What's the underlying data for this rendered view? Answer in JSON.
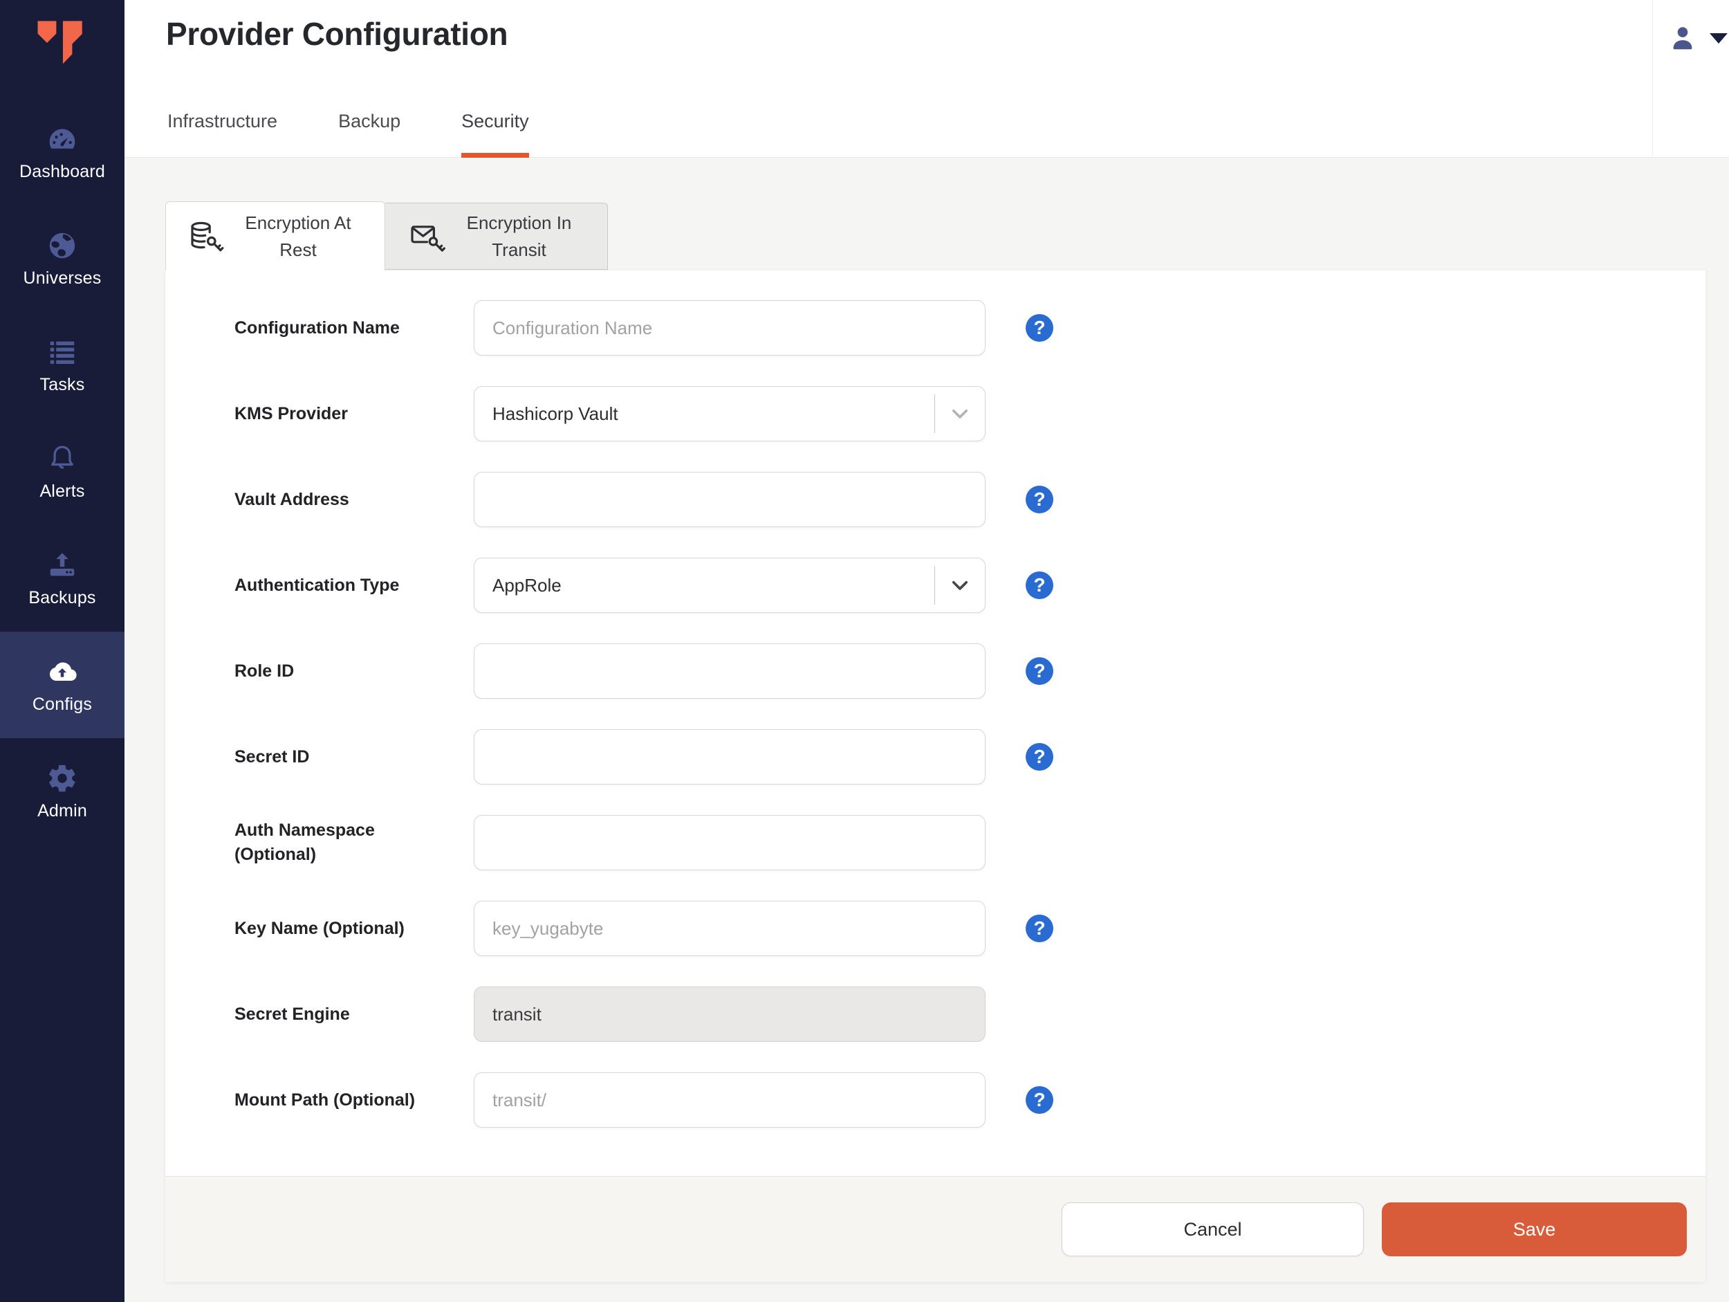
{
  "sidebar": {
    "items": [
      {
        "label": "Dashboard",
        "icon": "gauge-icon",
        "active": false
      },
      {
        "label": "Universes",
        "icon": "globe-icon",
        "active": false
      },
      {
        "label": "Tasks",
        "icon": "task-list-icon",
        "active": false
      },
      {
        "label": "Alerts",
        "icon": "bell-icon",
        "active": false
      },
      {
        "label": "Backups",
        "icon": "backup-upload-icon",
        "active": false
      },
      {
        "label": "Configs",
        "icon": "cloud-upload-icon",
        "active": true
      },
      {
        "label": "Admin",
        "icon": "gear-icon",
        "active": false
      }
    ]
  },
  "header": {
    "title": "Provider Configuration",
    "tabs": [
      {
        "label": "Infrastructure",
        "active": false
      },
      {
        "label": "Backup",
        "active": false
      },
      {
        "label": "Security",
        "active": true
      }
    ]
  },
  "security_tabs": [
    {
      "label": "Encryption At Rest",
      "icon": "database-key-icon",
      "active": true
    },
    {
      "label": "Encryption In Transit",
      "icon": "envelope-key-icon",
      "active": false
    }
  ],
  "form": {
    "fields": [
      {
        "label": "Configuration Name",
        "type": "text",
        "value": "",
        "placeholder": "Configuration Name",
        "help": true
      },
      {
        "label": "KMS Provider",
        "type": "select",
        "value": "Hashicorp Vault",
        "help": false
      },
      {
        "label": "Vault Address",
        "type": "text",
        "value": "",
        "placeholder": "",
        "help": true
      },
      {
        "label": "Authentication Type",
        "type": "select",
        "value": "AppRole",
        "help": true
      },
      {
        "label": "Role ID",
        "type": "text",
        "value": "",
        "placeholder": "",
        "help": true
      },
      {
        "label": "Secret ID",
        "type": "text",
        "value": "",
        "placeholder": "",
        "help": true
      },
      {
        "label": "Auth Namespace (Optional)",
        "type": "text",
        "value": "",
        "placeholder": "",
        "help": false
      },
      {
        "label": "Key Name (Optional)",
        "type": "text",
        "value": "",
        "placeholder": "key_yugabyte",
        "help": true
      },
      {
        "label": "Secret Engine",
        "type": "text-disabled",
        "value": "transit",
        "help": false
      },
      {
        "label": "Mount Path (Optional)",
        "type": "text",
        "value": "",
        "placeholder": "transit/",
        "help": true
      }
    ],
    "help_symbol": "?"
  },
  "footer": {
    "cancel_label": "Cancel",
    "save_label": "Save"
  },
  "colors": {
    "accent_orange": "#D95C3A",
    "tab_underline_orange": "#E2572E",
    "logo_orange": "#F26649",
    "help_blue": "#2A6BD2",
    "sidebar_bg": "#181C38",
    "sidebar_active_bg": "#2F3760",
    "sidebar_icon_muted": "#4D5A94"
  }
}
